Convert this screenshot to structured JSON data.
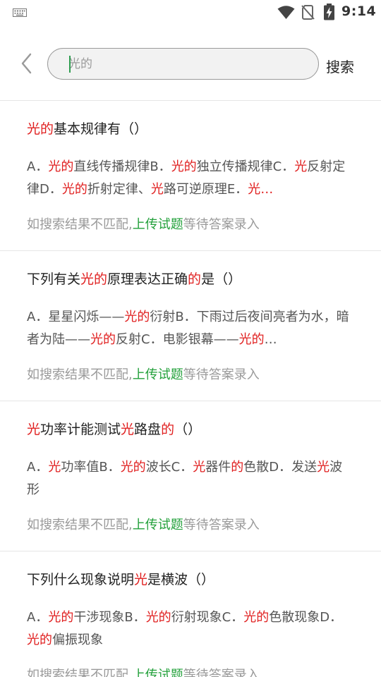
{
  "status_bar": {
    "time": "9:14",
    "icons": [
      "keyboard-icon",
      "wifi-icon",
      "no-sim-icon",
      "battery-charging-icon"
    ]
  },
  "search": {
    "query": "光的",
    "button_label": "搜索"
  },
  "hint": {
    "before": "如搜索结果不匹配,",
    "link": "上传试题",
    "after": "等待答案录入"
  },
  "results": [
    {
      "title_segments": [
        {
          "text": "光的",
          "hl": true
        },
        {
          "text": "基本规律有（）",
          "hl": false
        }
      ],
      "option_segments": [
        {
          "text": "A．",
          "hl": false
        },
        {
          "text": "光的",
          "hl": true
        },
        {
          "text": "直线传播规律B．",
          "hl": false
        },
        {
          "text": "光的",
          "hl": true
        },
        {
          "text": "独立传播规律C．",
          "hl": false
        },
        {
          "text": "光",
          "hl": true
        },
        {
          "text": "反射定律D．",
          "hl": false
        },
        {
          "text": "光的",
          "hl": true
        },
        {
          "text": "折射定律、",
          "hl": false
        },
        {
          "text": "光",
          "hl": true
        },
        {
          "text": "路可逆原理E．",
          "hl": false
        },
        {
          "text": "光…",
          "hl": true
        }
      ]
    },
    {
      "title_segments": [
        {
          "text": "下列有关",
          "hl": false
        },
        {
          "text": "光的",
          "hl": true
        },
        {
          "text": "原理表达正确",
          "hl": false
        },
        {
          "text": "的",
          "hl": true
        },
        {
          "text": "是（）",
          "hl": false
        }
      ],
      "option_segments": [
        {
          "text": "A．星星闪烁——",
          "hl": false
        },
        {
          "text": "光的",
          "hl": true
        },
        {
          "text": "衍射B．下雨过后夜间亮者为水，暗者为陆——",
          "hl": false
        },
        {
          "text": "光的",
          "hl": true
        },
        {
          "text": "反射C．电影银幕——",
          "hl": false
        },
        {
          "text": "光的",
          "hl": true
        },
        {
          "text": "…",
          "hl": false
        }
      ]
    },
    {
      "title_segments": [
        {
          "text": "光",
          "hl": true
        },
        {
          "text": "功率计能测试",
          "hl": false
        },
        {
          "text": "光",
          "hl": true
        },
        {
          "text": "路盘",
          "hl": false
        },
        {
          "text": "的",
          "hl": true
        },
        {
          "text": "（）",
          "hl": false
        }
      ],
      "option_segments": [
        {
          "text": "A．",
          "hl": false
        },
        {
          "text": "光",
          "hl": true
        },
        {
          "text": "功率值B．",
          "hl": false
        },
        {
          "text": "光的",
          "hl": true
        },
        {
          "text": "波长C．",
          "hl": false
        },
        {
          "text": "光",
          "hl": true
        },
        {
          "text": "器件",
          "hl": false
        },
        {
          "text": "的",
          "hl": true
        },
        {
          "text": "色散D．发送",
          "hl": false
        },
        {
          "text": "光",
          "hl": true
        },
        {
          "text": "波形",
          "hl": false
        }
      ]
    },
    {
      "title_segments": [
        {
          "text": "下列什么现象说明",
          "hl": false
        },
        {
          "text": "光",
          "hl": true
        },
        {
          "text": "是横波（）",
          "hl": false
        }
      ],
      "option_segments": [
        {
          "text": "A．",
          "hl": false
        },
        {
          "text": "光的",
          "hl": true
        },
        {
          "text": "干涉现象B．",
          "hl": false
        },
        {
          "text": "光的",
          "hl": true
        },
        {
          "text": "衍射现象C．",
          "hl": false
        },
        {
          "text": "光的",
          "hl": true
        },
        {
          "text": "色散现象D．",
          "hl": false
        },
        {
          "text": "光的",
          "hl": true
        },
        {
          "text": "偏振现象",
          "hl": false
        }
      ]
    }
  ],
  "colors": {
    "highlight": "#e02020",
    "link": "#22a03a",
    "hint": "#9a9a9a"
  }
}
